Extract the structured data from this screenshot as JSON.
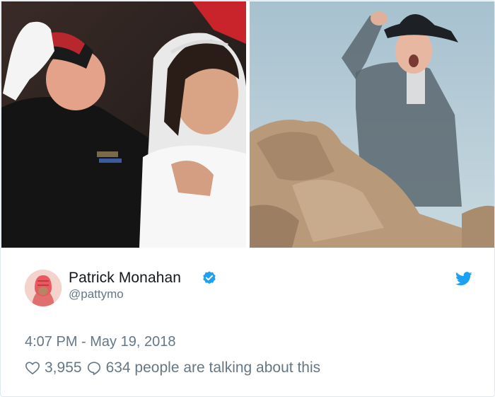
{
  "tweet": {
    "display_name": "Patrick Monahan",
    "handle": "@pattymo",
    "verified": true,
    "timestamp": "4:07 PM - May 19, 2018",
    "like_count": "3,955",
    "talking_text": "634 people are talking about this"
  },
  "icons": {
    "verified": "verified-badge-icon",
    "platform": "twitter-bird-icon",
    "like": "heart-icon",
    "reply": "speech-bubble-icon"
  },
  "colors": {
    "accent": "#1da1f2",
    "muted_text": "#657786",
    "primary_text": "#14171a",
    "border": "#e1e8ed"
  }
}
